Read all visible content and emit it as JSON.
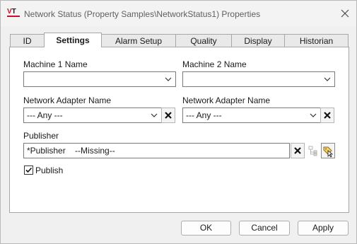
{
  "window": {
    "title": "Network Status (Property Samples\\NetworkStatus1) Properties",
    "logo": {
      "mark_v": "V",
      "mark_t": "T",
      "accent": "#c8102e"
    }
  },
  "tabs": [
    {
      "label": "ID"
    },
    {
      "label": "Settings",
      "active": true
    },
    {
      "label": "Alarm Setup"
    },
    {
      "label": "Quality"
    },
    {
      "label": "Display"
    },
    {
      "label": "Historian"
    }
  ],
  "settings": {
    "machine1": {
      "label": "Machine 1 Name",
      "value": ""
    },
    "machine2": {
      "label": "Machine 2 Name",
      "value": ""
    },
    "adapter1": {
      "label": "Network Adapter Name",
      "value": "--- Any ---"
    },
    "adapter2": {
      "label": "Network Adapter Name",
      "value": "--- Any ---"
    },
    "publisher": {
      "label": "Publisher",
      "value": "*Publisher    --Missing--"
    },
    "publish": {
      "label": "Publish",
      "checked": true
    }
  },
  "buttons": {
    "ok": "OK",
    "cancel": "Cancel",
    "apply": "Apply"
  },
  "icons": {
    "close": "close-icon",
    "dropdown": "chevron-down-icon",
    "clear": "x-icon",
    "tree_browse": "tree-browse-icon",
    "select_tag": "tag-select-icon"
  }
}
